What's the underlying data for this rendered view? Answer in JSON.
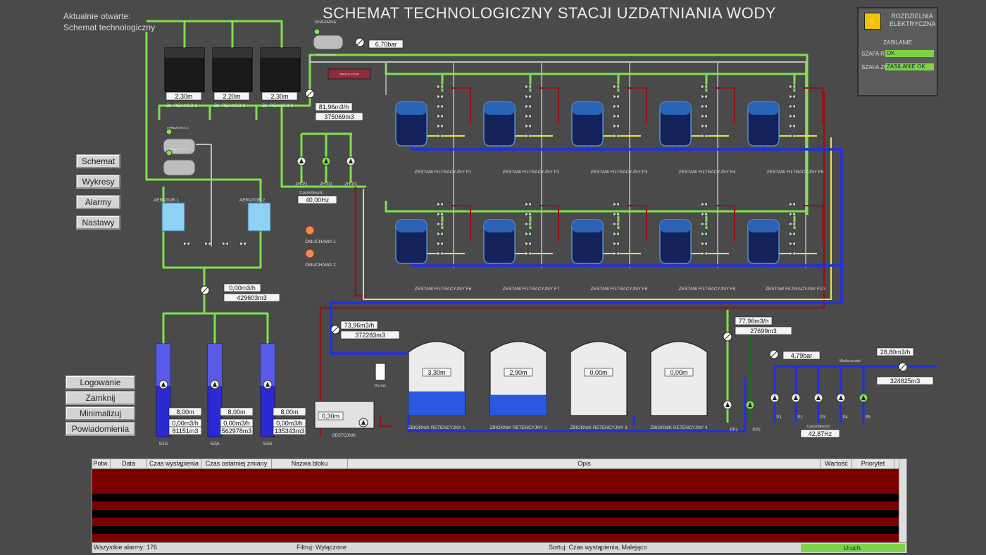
{
  "header": {
    "title": "SCHEMAT TECHNOLOGICZNY STACJI UZDATNIANIA WODY",
    "current_open_label": "Aktualnie otwarte:",
    "current_open_value": "Schemat technologiczny"
  },
  "nav": {
    "schemat": "Schemat",
    "wykresy": "Wykresy",
    "alarmy": "Alarmy",
    "nastawy": "Nastawy"
  },
  "system_buttons": {
    "logowanie": "Logowanie",
    "zamknij": "Zamknij wizualizację",
    "minimalizuj": "Minimalizuj",
    "powiadomienia": "Powiadomienia"
  },
  "electrical": {
    "title": "ROZDZIELNIA ELEKTRYCZNA",
    "zasilanie": "ZASILANIE",
    "szafa_rt_label": "SZAFA RT",
    "szafa_rt_value": "OK",
    "szafa_zh_label": "SZAFA ZH",
    "szafa_zh_value": "ZASILANIE OK"
  },
  "reactors": [
    {
      "name": "Zb. REAKCJI 1",
      "level": "2,30m"
    },
    {
      "name": "Zb. REAKCJI 2",
      "level": "2,20m"
    },
    {
      "name": "Zb. REAKCJI 3",
      "level": "2,30m"
    }
  ],
  "top_flow": {
    "flow": "81,96m3/h",
    "total": "375069m3"
  },
  "top_pressure": "6,70bar",
  "compressor": {
    "name": "SPREŻARKA"
  },
  "compressor_pipe": "Woda surowa",
  "controller_box": "REGULATOR",
  "zh_pumps": [
    "ZH-P1",
    "ZH-P2",
    "ZH-P3"
  ],
  "zh_freq": {
    "label": "Częstotliwość",
    "value": "40,00Hz"
  },
  "aerators": [
    "AERATOR 1",
    "AERATOR 2"
  ],
  "compressors_small": [
    "SPREŻARKA 1",
    "SPREŻARKA 2"
  ],
  "blowers": [
    "DMUCHAWA 1",
    "DMUCHAWA 2"
  ],
  "mid_flow": {
    "flow": "0,00m3/h",
    "total": "429603m3"
  },
  "wells": [
    {
      "name": "S1A",
      "level": "8,00m",
      "flow": "0,00m3/h",
      "total": "81151m3"
    },
    {
      "name": "S2A",
      "level": "8,00m",
      "flow": "0,00m3/h",
      "total": "562978m3"
    },
    {
      "name": "S3A",
      "level": "8,00m",
      "flow": "0,00m3/h",
      "total": "135343m3"
    }
  ],
  "filters": [
    "ZESTAW FILTRACYJNY F1",
    "ZESTAW FILTRACYJNY F2",
    "ZESTAW FILTRACYJNY F3",
    "ZESTAW FILTRACYJNY F4",
    "ZESTAW FILTRACYJNY F5",
    "ZESTAW FILTRACYJNY F6",
    "ZESTAW FILTRACYJNY F7",
    "ZESTAW FILTRACYJNY F8",
    "ZESTAW FILTRACYJNY F9",
    "ZESTAW FILTRACYJNY F10"
  ],
  "wash_flow": {
    "flow": "73,96m3/h",
    "total": "372283m3"
  },
  "retention": [
    {
      "name": "ZBIORNIK RETENCYJNY 1",
      "level": "3,30m",
      "fill": 0.35
    },
    {
      "name": "ZBIORNIK RETENCYJNY 2",
      "level": "2,90m",
      "fill": 0.3
    },
    {
      "name": "ZBIORNIK RETENCYJNY 3",
      "level": "0,00m",
      "fill": 0.0
    },
    {
      "name": "ZBIORNIK RETENCYJNY 4",
      "level": "0,00m",
      "fill": 0.0
    }
  ],
  "settler": {
    "name": "ODSTOJNIK",
    "level": "0,30m"
  },
  "dosing": {
    "name": "Dozow."
  },
  "pp_flow": {
    "flow": "77,96m3/h",
    "total": "27699m3"
  },
  "pp_pumps": [
    "PP1",
    "PP2"
  ],
  "out_pressure": "4,79bar",
  "out_flow": {
    "flow": "28,80m3/h",
    "total": "324825m3"
  },
  "out_pipe_label": "Woda na sieć",
  "out_pumps": [
    "P1",
    "P2",
    "P3",
    "P4",
    "P5"
  ],
  "out_freq": {
    "label": "Częstotliwość",
    "value": "42,87Hz"
  },
  "alarm_table": {
    "columns": [
      "Potw.",
      "Data",
      "Czas wystąpienia",
      "Czas ostatniej zmiany",
      "Nazwa bloku",
      "Opis",
      "Wartość",
      "Priorytet"
    ],
    "total_label": "Wszystkie alarmy: 176",
    "filter_label": "Filtruj: Wyłączone",
    "sort_label": "Sortuj: Czas wystąpienia, Malejąco",
    "status": "Uruch."
  },
  "colors": {
    "green": "#7ee24a",
    "blue": "#1f2fe6",
    "red": "#8e1616",
    "yellow": "#e9e24c",
    "gray": "#bdbdbd"
  }
}
